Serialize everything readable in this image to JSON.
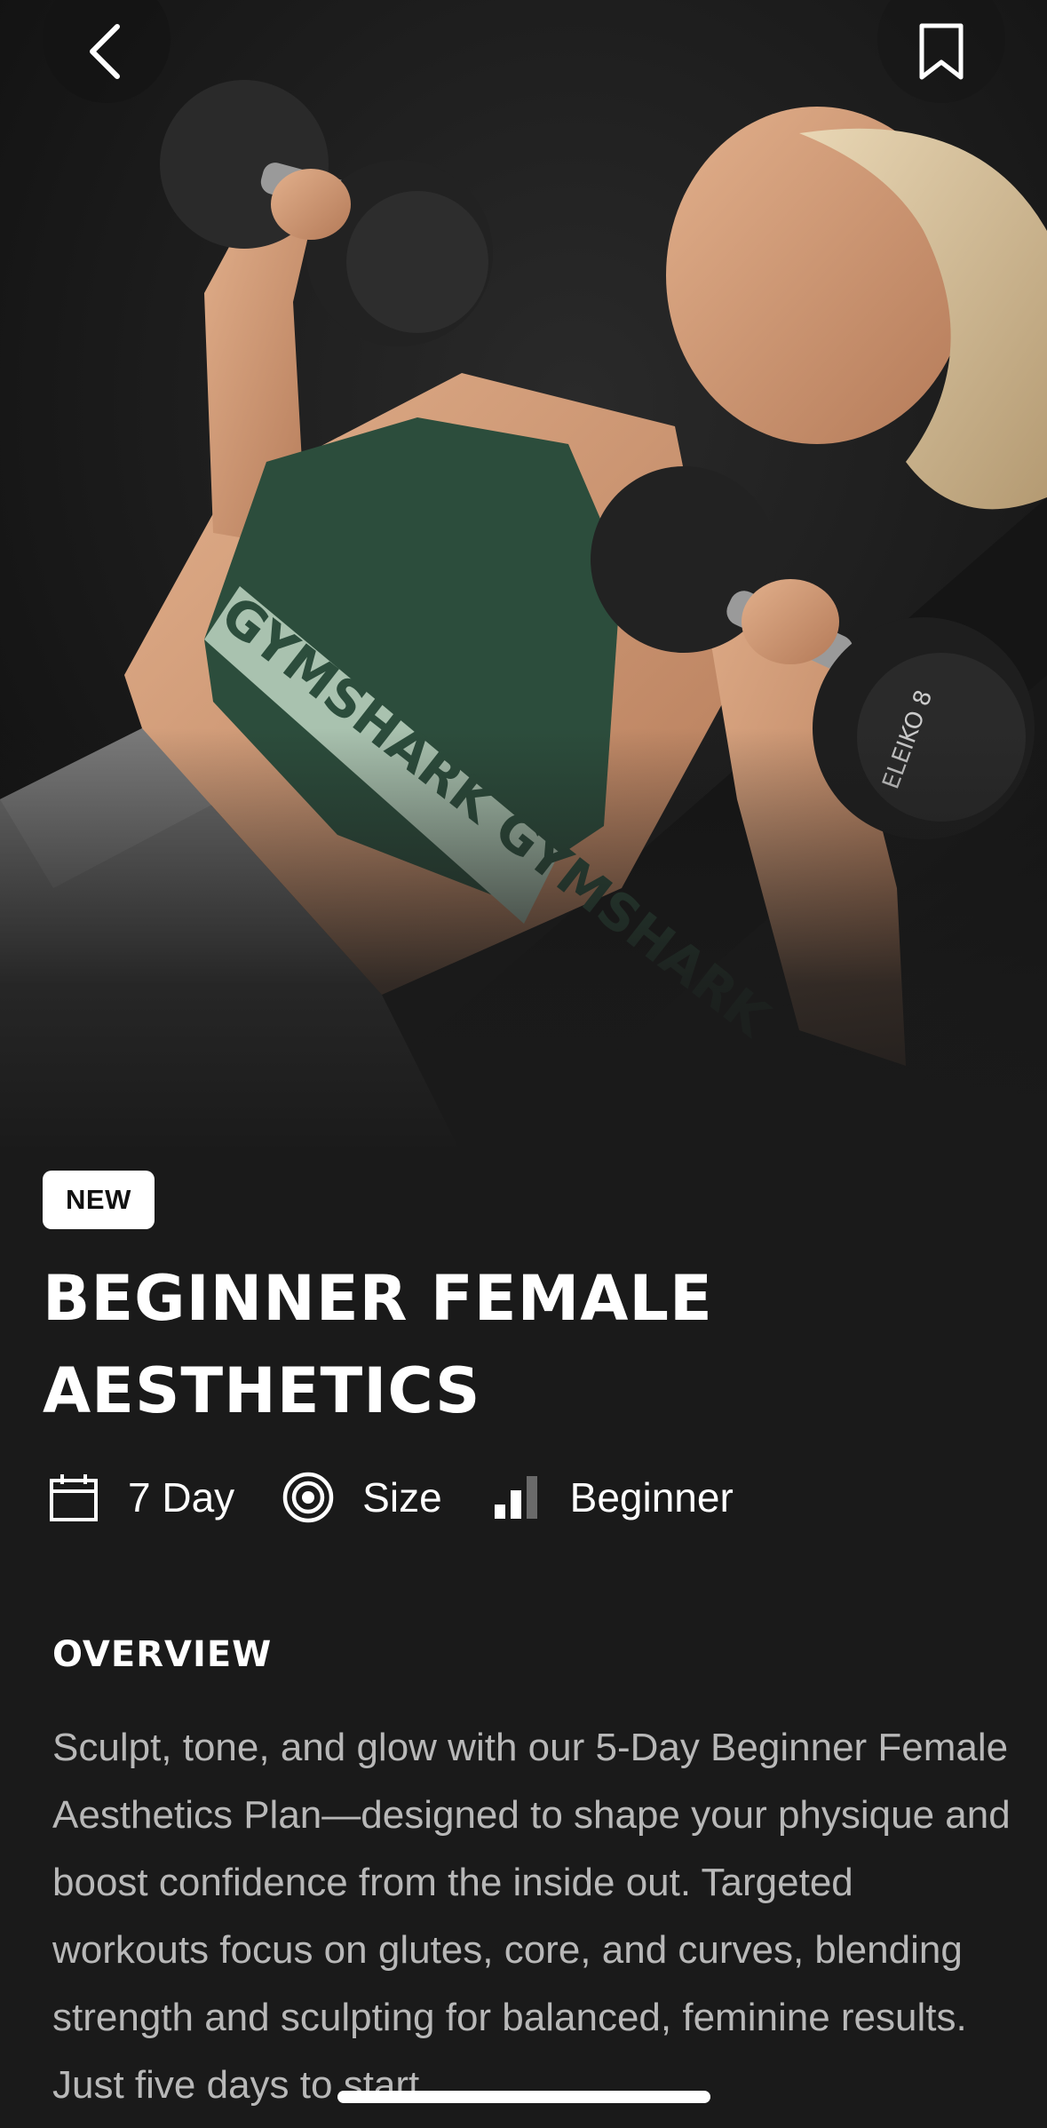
{
  "header": {
    "back_icon": "chevron-left-icon",
    "bookmark_icon": "bookmark-icon"
  },
  "hero": {
    "image": "woman-dumbbell-press-photo",
    "bra_text": "GYMSHARK GYMSHARK",
    "dumbbell_text": "ELEIKO 8"
  },
  "badge": "NEW",
  "title": "BEGINNER FEMALE AESTHETICS",
  "meta": [
    {
      "icon": "calendar-icon",
      "label": "7 Day"
    },
    {
      "icon": "target-icon",
      "label": "Size"
    },
    {
      "icon": "level-bars-icon",
      "label": "Beginner",
      "level_filled": 2,
      "level_total": 3
    }
  ],
  "overview": {
    "heading": "OVERVIEW",
    "text": "Sculpt, tone, and glow with our 5-Day Beginner Female Aesthetics Plan—designed to shape your physique and boost confidence from the inside out. Targeted workouts focus on glutes, core, and curves, blending strength and sculpting for balanced, feminine results. Just five days to start"
  },
  "colors": {
    "background": "#1a1a1a",
    "text_primary": "#ffffff",
    "text_secondary": "#b8b8b8",
    "badge_bg": "#ffffff",
    "bra_green": "#2c4d3c"
  }
}
